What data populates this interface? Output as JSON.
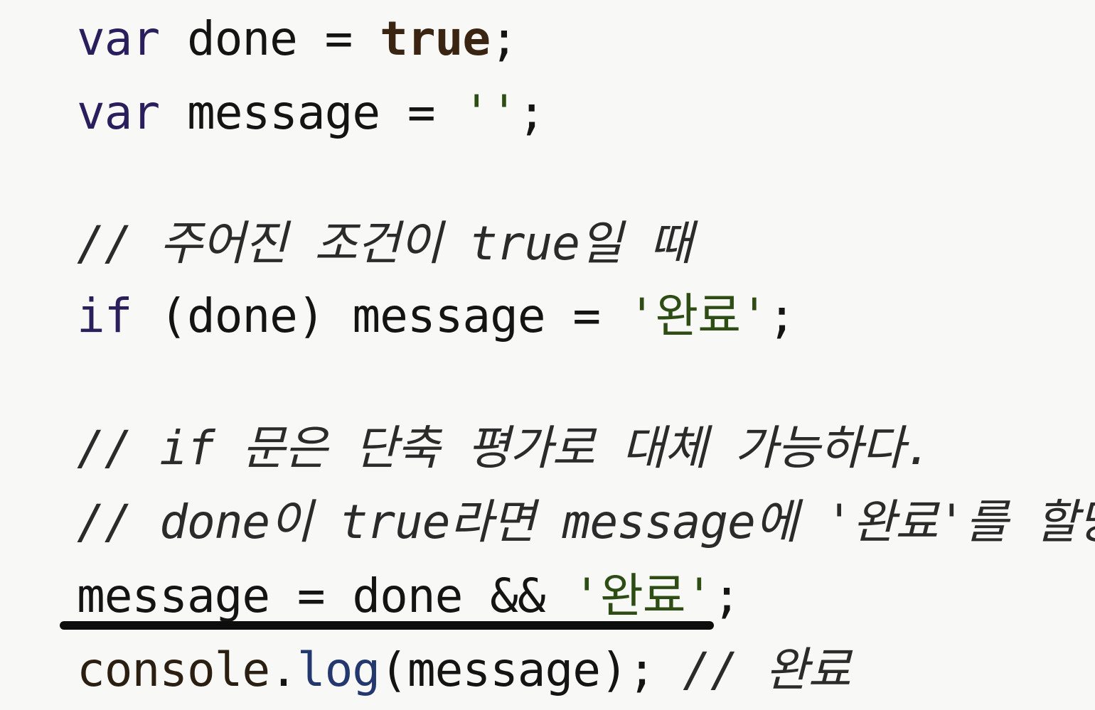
{
  "code": {
    "line1": {
      "kw": "var",
      "name": "done",
      "eq": "=",
      "value": "true",
      "semi": ";"
    },
    "line2": {
      "kw": "var",
      "name": "message",
      "eq": "=",
      "value": "''",
      "semi": ";"
    },
    "comment1": "// 주어진 조건이 true일 때",
    "line3": {
      "kw": "if",
      "cond": "(done)",
      "name": "message",
      "eq": "=",
      "value": "'완료'",
      "semi": ";"
    },
    "comment2": "// if 문은 단축 평가로 대체 가능하다.",
    "comment3": "// done이 true라면 message에 '완료'를 할당",
    "line4": {
      "name": "message",
      "eq": "=",
      "left": "done",
      "op": "&&",
      "value": "'완료'",
      "semi": ";"
    },
    "line5": {
      "obj": "console",
      "dot": ".",
      "fn": "log",
      "args": "(message);",
      "comment": "// 완료"
    }
  }
}
